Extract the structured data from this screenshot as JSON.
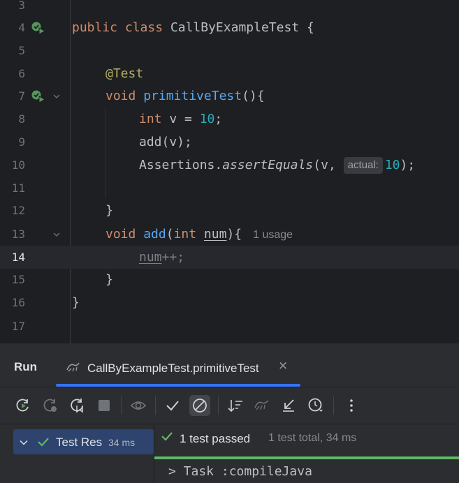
{
  "editor": {
    "lines": [
      {
        "num": "3"
      },
      {
        "num": "4",
        "kw1": "public",
        "kw2": "class",
        "name": "CallByExampleTest",
        "brace": "{"
      },
      {
        "num": "5"
      },
      {
        "num": "6",
        "annotation": "@Test"
      },
      {
        "num": "7",
        "kw": "void",
        "fn": "primitiveTest",
        "rest": "(){"
      },
      {
        "num": "8",
        "kw": "int",
        "mid": "v =",
        "value": "10",
        "end": ";"
      },
      {
        "num": "9",
        "text": "add(v);"
      },
      {
        "num": "10",
        "cls": "Assertions.",
        "method": "assertEquals",
        "args": "(v,",
        "hint": "actual:",
        "value": "10",
        "end": ");"
      },
      {
        "num": "11"
      },
      {
        "num": "12",
        "text": "}"
      },
      {
        "num": "13",
        "kw": "void",
        "fn": "add",
        "open": "(",
        "ptype": "int",
        "pname": "num",
        "close": "){",
        "usage": "1 usage"
      },
      {
        "num": "14",
        "var": "num",
        "op": "++;"
      },
      {
        "num": "15",
        "text": "}"
      },
      {
        "num": "16",
        "text": "}"
      },
      {
        "num": "17"
      }
    ]
  },
  "run_panel": {
    "title": "Run",
    "tab": {
      "label": "CallByExampleTest.primitiveTest",
      "close": "×"
    },
    "toolbar": {
      "icons": [
        "rerun-icon",
        "rerun-failed-icon",
        "toggle-auto-test-icon",
        "stop-icon",
        "show-ignored-icon",
        "show-passed-icon",
        "show-ignored-tests-icon",
        "sort-icon",
        "import-tests-icon",
        "collapse-icon",
        "history-icon",
        "more-icon"
      ]
    },
    "tree": {
      "label": "Test Res",
      "time": "34 ms"
    },
    "status": {
      "text": "1 test passed",
      "sub": "1 test total, 34 ms"
    },
    "console": {
      "line": "> Task :compileJava"
    }
  },
  "colors": {
    "keyword": "#cf8e6d",
    "function": "#56a8f5",
    "number": "#2aacb8",
    "annotation": "#b3ae60",
    "accent": "#3574f0",
    "success": "#5fb865"
  }
}
